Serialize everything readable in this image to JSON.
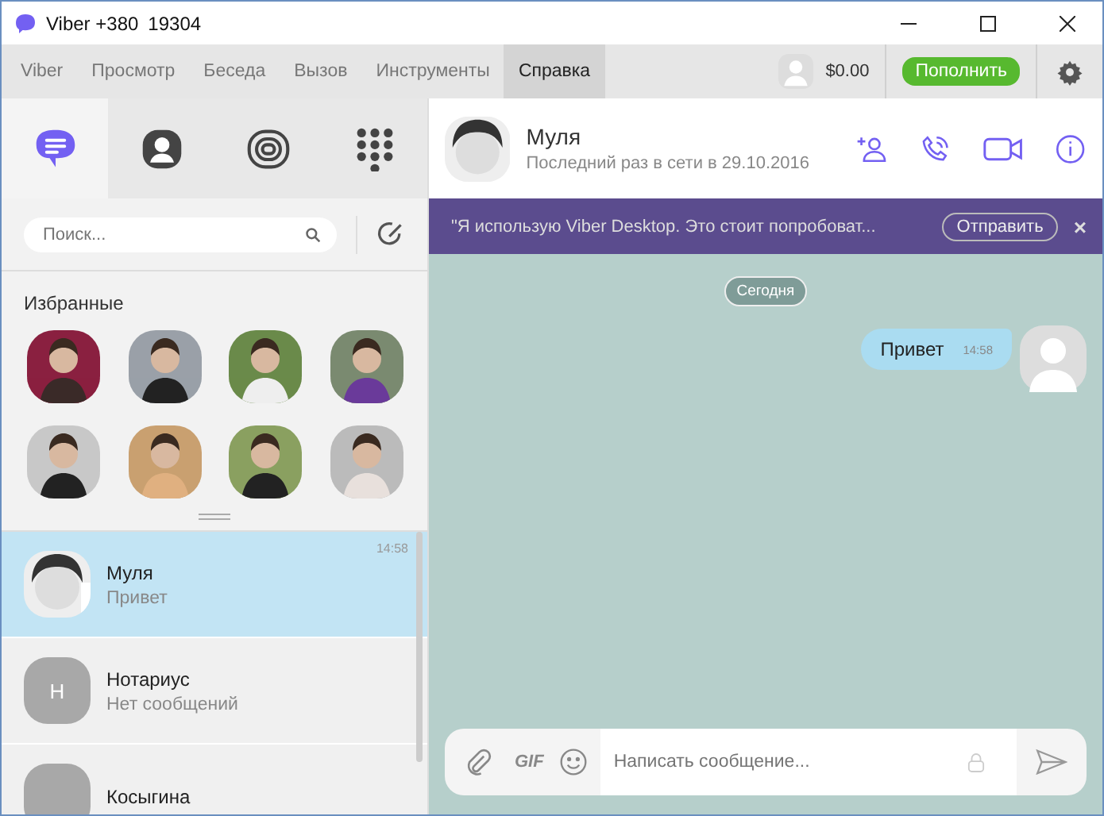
{
  "window": {
    "title_parts": [
      "Viber +380",
      "19304"
    ]
  },
  "menu": [
    {
      "label": "Viber",
      "selected": false
    },
    {
      "label": "Просмотр",
      "selected": false
    },
    {
      "label": "Беседа",
      "selected": false
    },
    {
      "label": "Вызов",
      "selected": false
    },
    {
      "label": "Инструменты",
      "selected": false
    },
    {
      "label": "Справка",
      "selected": true
    }
  ],
  "account": {
    "balance": "$0.00",
    "topup": "Пополнить"
  },
  "nav_tabs": [
    {
      "kind": "chats",
      "selected": true
    },
    {
      "kind": "contacts",
      "selected": false
    },
    {
      "kind": "public",
      "selected": false
    },
    {
      "kind": "dialpad",
      "selected": false
    }
  ],
  "search": {
    "placeholder": "Поиск..."
  },
  "favorites": {
    "title": "Избранные"
  },
  "chats": [
    {
      "name": "Муля",
      "preview": "Привет",
      "time": "14:58",
      "selected": true
    },
    {
      "name": "Нотариус",
      "preview": "Нет сообщений",
      "selected": false,
      "avatar": {
        "kind": "letter",
        "text": "Н"
      }
    },
    {
      "name": "Косыгина",
      "selected": false,
      "avatar": {
        "kind": "blank"
      }
    }
  ],
  "conversation": {
    "name": "Муля",
    "status": "Последний раз в сети в 29.10.2016"
  },
  "banner": {
    "text": "\"Я использую Viber Desktop. Это стоит попробоват...",
    "button": "Отправить",
    "close": "×"
  },
  "messages": {
    "date": "Сегодня",
    "items": [
      {
        "text": "Привет",
        "time": "14:58"
      }
    ]
  },
  "composer": {
    "gif": "GIF",
    "placeholder": "Написать сообщение..."
  }
}
